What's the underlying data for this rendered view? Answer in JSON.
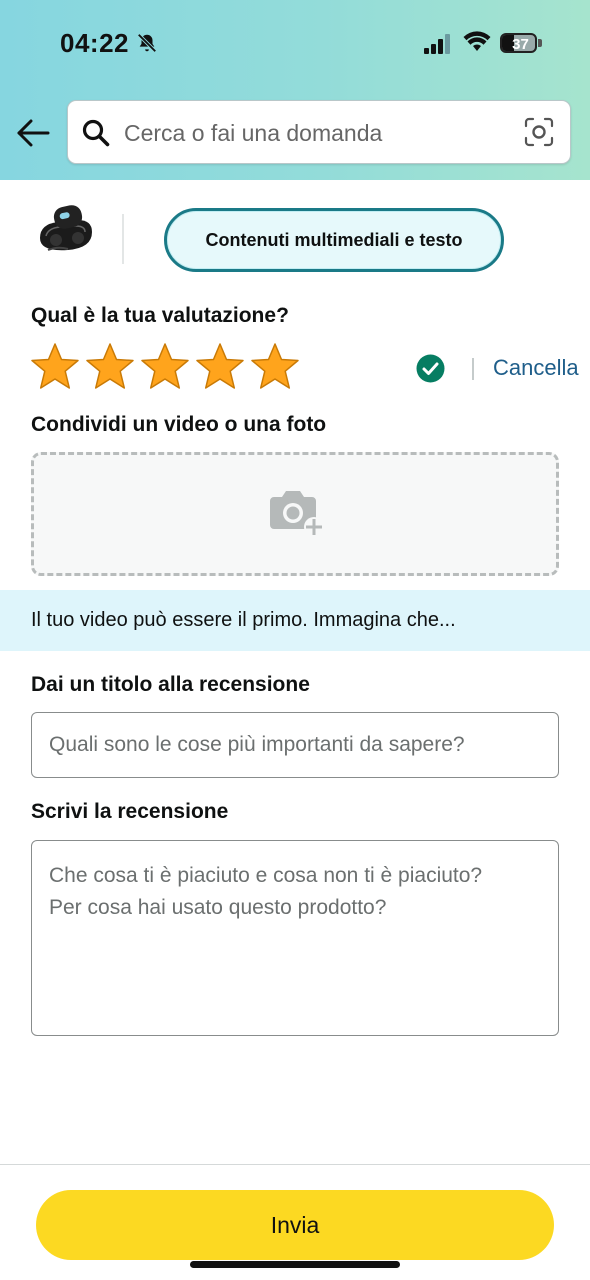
{
  "status_bar": {
    "time": "04:22",
    "battery_level": "37",
    "battery_fraction": 0.37
  },
  "search": {
    "placeholder": "Cerca o fai una domanda"
  },
  "mode_pill": {
    "label": "Contenuti multimediali e testo"
  },
  "rating": {
    "question": "Qual è la tua valutazione?",
    "stars": 5,
    "max_stars": 5,
    "star_color": "#ffa41c",
    "cancel_label": "Cancella",
    "confirmed_color": "#067d62"
  },
  "media": {
    "label": "Condividi un video o una foto"
  },
  "info_banner": {
    "text": "Il tuo video può essere il primo. Immagina che..."
  },
  "review_title": {
    "label": "Dai un titolo alla recensione",
    "placeholder": "Quali sono le cose più importanti da sapere?"
  },
  "review_body": {
    "label": "Scrivi la recensione",
    "placeholder": "Che cosa ti è piaciuto e cosa non ti è piaciuto?\nPer cosa hai usato questo prodotto?"
  },
  "submit": {
    "label": "Invia",
    "color": "#fcd922"
  },
  "icons": {
    "back": "arrow-left-icon",
    "search": "search-icon",
    "camera_search": "camera-search-icon",
    "check": "check-circle-icon",
    "add_photo": "camera-plus-icon",
    "bell_off": "bell-slash-icon",
    "signal": "cellular-signal-icon",
    "wifi": "wifi-icon",
    "battery": "battery-icon"
  }
}
